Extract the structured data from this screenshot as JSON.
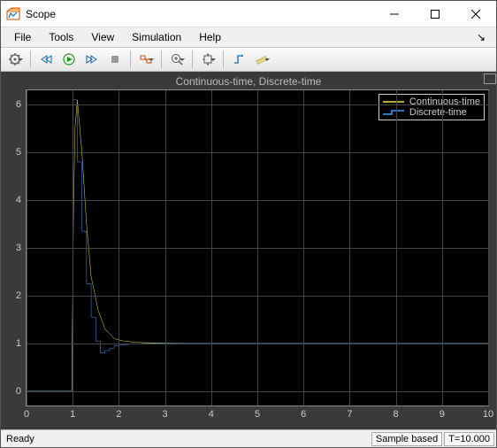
{
  "window": {
    "title": "Scope"
  },
  "menubar": {
    "items": [
      "File",
      "Tools",
      "View",
      "Simulation",
      "Help"
    ]
  },
  "toolbar": {
    "buttons": [
      {
        "name": "config-gear",
        "dd": true
      },
      {
        "name": "step-back"
      },
      {
        "name": "run"
      },
      {
        "name": "step-forward"
      },
      {
        "name": "stop"
      },
      {
        "name": "highlight-signal",
        "dd": true
      },
      {
        "name": "zoom-in",
        "dd": true
      },
      {
        "name": "axes-scaling",
        "dd": true
      },
      {
        "name": "triggers"
      },
      {
        "name": "measurements",
        "dd": true
      }
    ]
  },
  "plot": {
    "title": "Continuous-time, Discrete-time",
    "legend": [
      {
        "label": "Continuous-time",
        "color": "#f2e24b"
      },
      {
        "label": "Discrete-time",
        "color": "#3ea0ff"
      }
    ],
    "x_ticks": [
      0,
      1,
      2,
      3,
      4,
      5,
      6,
      7,
      8,
      9,
      10
    ],
    "y_ticks": [
      0,
      1,
      2,
      3,
      4,
      5,
      6
    ]
  },
  "chart_data": {
    "type": "line",
    "title": "Continuous-time, Discrete-time",
    "xlabel": "",
    "ylabel": "",
    "xlim": [
      0,
      10
    ],
    "ylim": [
      -0.3,
      6.3
    ],
    "series": [
      {
        "name": "Continuous-time",
        "color": "#f2e24b",
        "x": [
          0,
          0.98,
          1.0,
          1.02,
          1.05,
          1.1,
          1.2,
          1.3,
          1.4,
          1.55,
          1.7,
          1.9,
          2.1,
          2.4,
          2.8,
          3.5,
          5.0,
          10.0
        ],
        "y": [
          0.0,
          0.0,
          2.0,
          4.0,
          5.5,
          6.1,
          5.0,
          3.5,
          2.4,
          1.7,
          1.3,
          1.1,
          1.05,
          1.02,
          1.01,
          1.0,
          1.0,
          1.0
        ]
      },
      {
        "name": "Discrete-time",
        "color": "#3ea0ff",
        "step": true,
        "x": [
          0,
          1.0,
          1.1,
          1.2,
          1.3,
          1.4,
          1.5,
          1.6,
          1.7,
          1.8,
          1.9,
          2.0,
          2.2,
          2.5,
          3.0,
          10.0
        ],
        "y": [
          0.0,
          6.1,
          4.8,
          3.35,
          2.25,
          1.55,
          1.05,
          0.8,
          0.85,
          0.9,
          0.95,
          0.97,
          0.99,
          1.0,
          1.0,
          1.0
        ]
      }
    ]
  },
  "statusbar": {
    "ready": "Ready",
    "mode": "Sample based",
    "time": "T=10.000"
  }
}
